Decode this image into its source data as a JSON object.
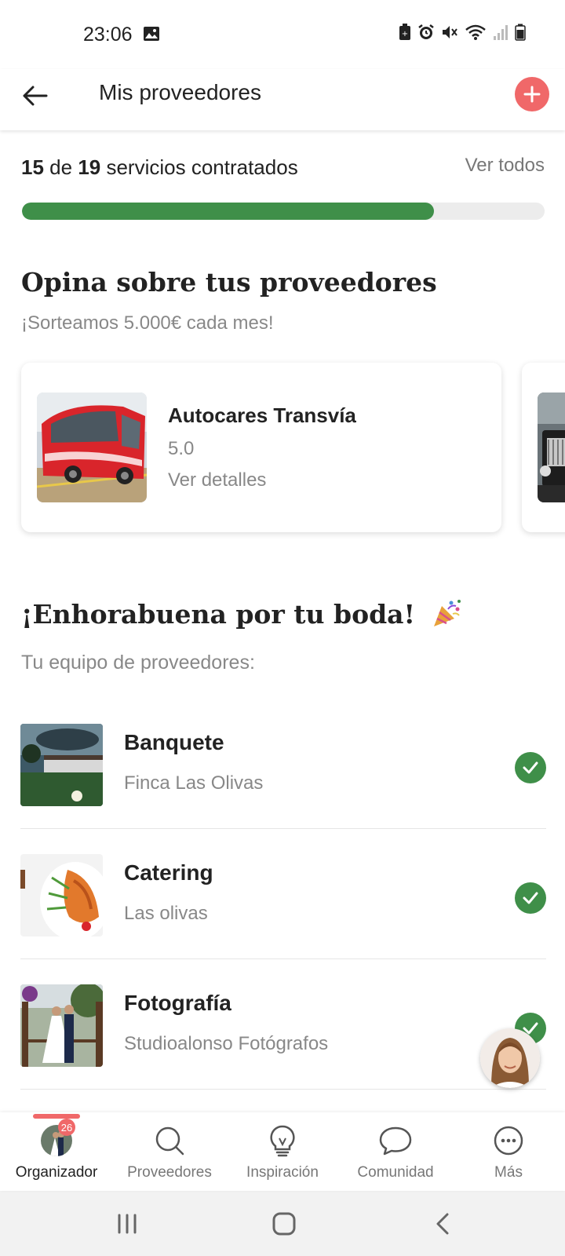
{
  "status_bar": {
    "time": "23:06",
    "icons": [
      "image-icon",
      "battery-saver-icon",
      "alarm-icon",
      "mute-icon",
      "wifi-icon",
      "signal-icon",
      "battery-icon"
    ]
  },
  "header": {
    "title": "Mis proveedores",
    "back_icon": "arrow-left-icon",
    "add_icon": "plus-icon"
  },
  "progress": {
    "contracted": "15",
    "connector": "de",
    "total": "19",
    "suffix": "servicios contratados",
    "see_all": "Ver todos",
    "fraction": 0.789
  },
  "reviews": {
    "title": "Opina sobre tus proveedores",
    "subtitle": "¡Sorteamos 5.000€ cada mes!",
    "cards": [
      {
        "name": "Autocares Transvía",
        "rating": "5.0",
        "details": "Ver detalles"
      }
    ]
  },
  "team": {
    "title": "¡Enhorabuena por tu boda!",
    "subtitle": "Tu equipo de proveedores:",
    "vendors": [
      {
        "category": "Banquete",
        "name": "Finca Las Olivas"
      },
      {
        "category": "Catering",
        "name": "Las olivas"
      },
      {
        "category": "Fotografía",
        "name": "Studioalonso Fotógrafos"
      }
    ]
  },
  "bottom_nav": {
    "badge": "26",
    "items": [
      {
        "label": "Organizador",
        "icon": "avatar"
      },
      {
        "label": "Proveedores",
        "icon": "search-icon"
      },
      {
        "label": "Inspiración",
        "icon": "lightbulb-icon"
      },
      {
        "label": "Comunidad",
        "icon": "chat-bubble-icon"
      },
      {
        "label": "Más",
        "icon": "more-icon"
      }
    ]
  },
  "colors": {
    "accent": "#f06869",
    "progress_green": "#3f8f49",
    "muted_text": "#888888"
  }
}
